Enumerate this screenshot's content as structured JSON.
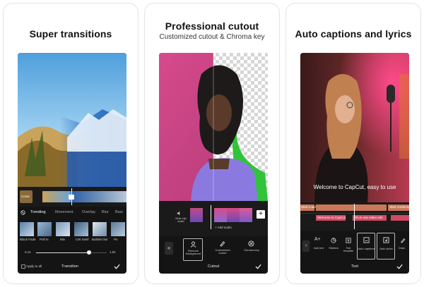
{
  "panels": [
    {
      "title": "Super transitions",
      "tabs": [
        "Trending",
        "Movement",
        "Overlay",
        "Blur",
        "Basi"
      ],
      "effects": [
        "Black Fade",
        "Pull In",
        "Mix",
        "CW Swirl",
        "Bubble blur",
        "Pu"
      ],
      "slider_min": "0.1s",
      "slider_max": "1.5s",
      "slider_level": 0.75,
      "cover_label": "Cover",
      "apply_all": "Apply to all",
      "footer": "Transition"
    },
    {
      "title": "Professional cutout",
      "subtitle": "Customized cutout & Chroma key",
      "mute_label": "Mute clip audio",
      "add_audio": "+ Add audio",
      "tools": [
        "Remove background",
        "Customized cutout",
        "Chroma key"
      ],
      "footer": "Cutout"
    },
    {
      "title": "Auto captions and lyrics",
      "caption": "Welcome to CapCut, easy to use",
      "caption_chips": [
        "Welcome to CapCut",
        "All on one video edit"
      ],
      "side_chips": [
        "Start Loading",
        "Start rendering"
      ],
      "tools": [
        "Add text",
        "Stickers",
        "Text template",
        "Auto captions",
        "Auto lyrics",
        "Draw"
      ],
      "footer": "Text"
    }
  ],
  "colors": {
    "accent_green": "#2fc43a",
    "text_chip": "#c9785a",
    "caption_chip": "#d24a64",
    "track_bg": "#2a2a2a"
  }
}
